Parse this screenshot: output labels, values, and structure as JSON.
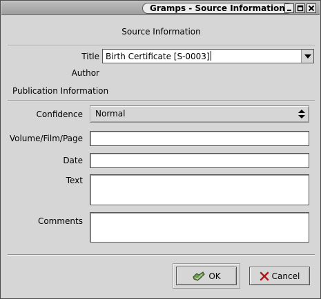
{
  "window": {
    "title": "Gramps - Source Information"
  },
  "dialog": {
    "section_title": "Source Information",
    "title_label": "Title",
    "title_value": "Birth Certificate [S-0003]",
    "author_label": "Author",
    "publication_label": "Publication Information",
    "confidence_label": "Confidence",
    "confidence_value": "Normal",
    "volume_label": "Volume/Film/Page",
    "volume_value": "",
    "date_label": "Date",
    "date_value": "",
    "text_label": "Text",
    "text_value": "",
    "comments_label": "Comments",
    "comments_value": ""
  },
  "buttons": {
    "ok_label": "OK",
    "cancel_label": "Cancel"
  },
  "icons": {
    "ok": "ok-check-icon",
    "cancel": "cancel-x-icon",
    "minimize": "minimize-icon",
    "maximize": "maximize-icon",
    "close": "close-icon"
  }
}
